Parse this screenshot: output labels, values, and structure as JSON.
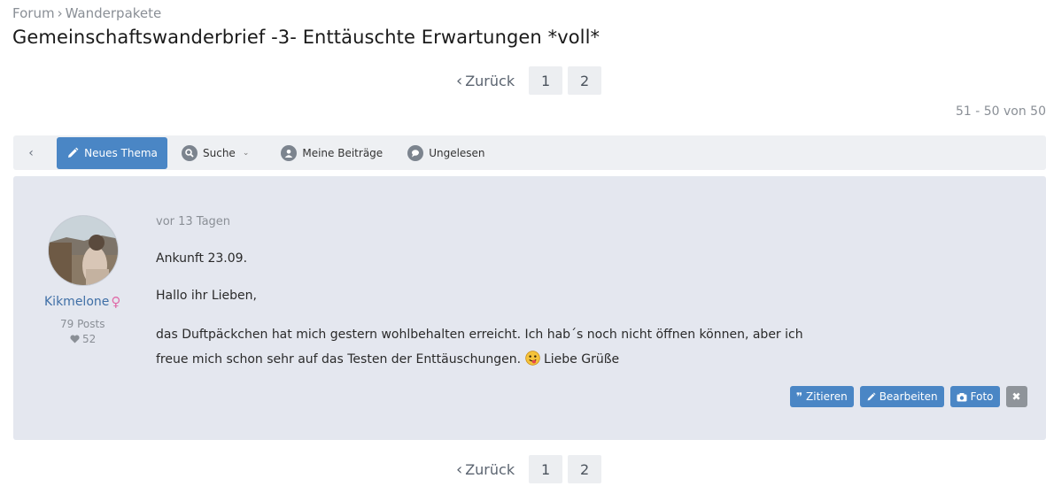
{
  "breadcrumb": {
    "root": "Forum",
    "separator": "›",
    "current": "Wanderpakete"
  },
  "thread": {
    "title": "Gemeinschaftswanderbrief -3- Enttäuschte Erwartungen *voll*"
  },
  "pagination": {
    "prev_label": "Zurück",
    "prev_icon": "chevron-left-icon",
    "pages": [
      "1",
      "2"
    ],
    "range": "51 - 50 von 50"
  },
  "toolbar": {
    "back_icon": "chevron-left-icon",
    "new_thread": "Neues Thema",
    "search": "Suche",
    "my_posts": "Meine Beiträge",
    "unread": "Ungelesen"
  },
  "post": {
    "username": "Kikmelone",
    "gender_symbol": "♀",
    "posts": "79 Posts",
    "likes": "52",
    "time": "vor 13 Tagen",
    "line1": "Ankunft 23.09.",
    "line2": "Hallo ihr Lieben,",
    "line3a": "das Duftpäckchen hat mich gestern wohlbehalten erreicht. Ich hab´s noch nicht öffnen können, aber ich freue mich schon sehr auf das Testen der Enttäuschungen.",
    "line3b": "Liebe Grüße",
    "actions": {
      "quote": "Zitieren",
      "edit": "Bearbeiten",
      "photo": "Foto"
    }
  },
  "colors": {
    "accent": "#4a86c5",
    "post_bg": "#e4e7ef",
    "toolbar_bg": "#eef0f3",
    "username": "#3f6fa6"
  }
}
